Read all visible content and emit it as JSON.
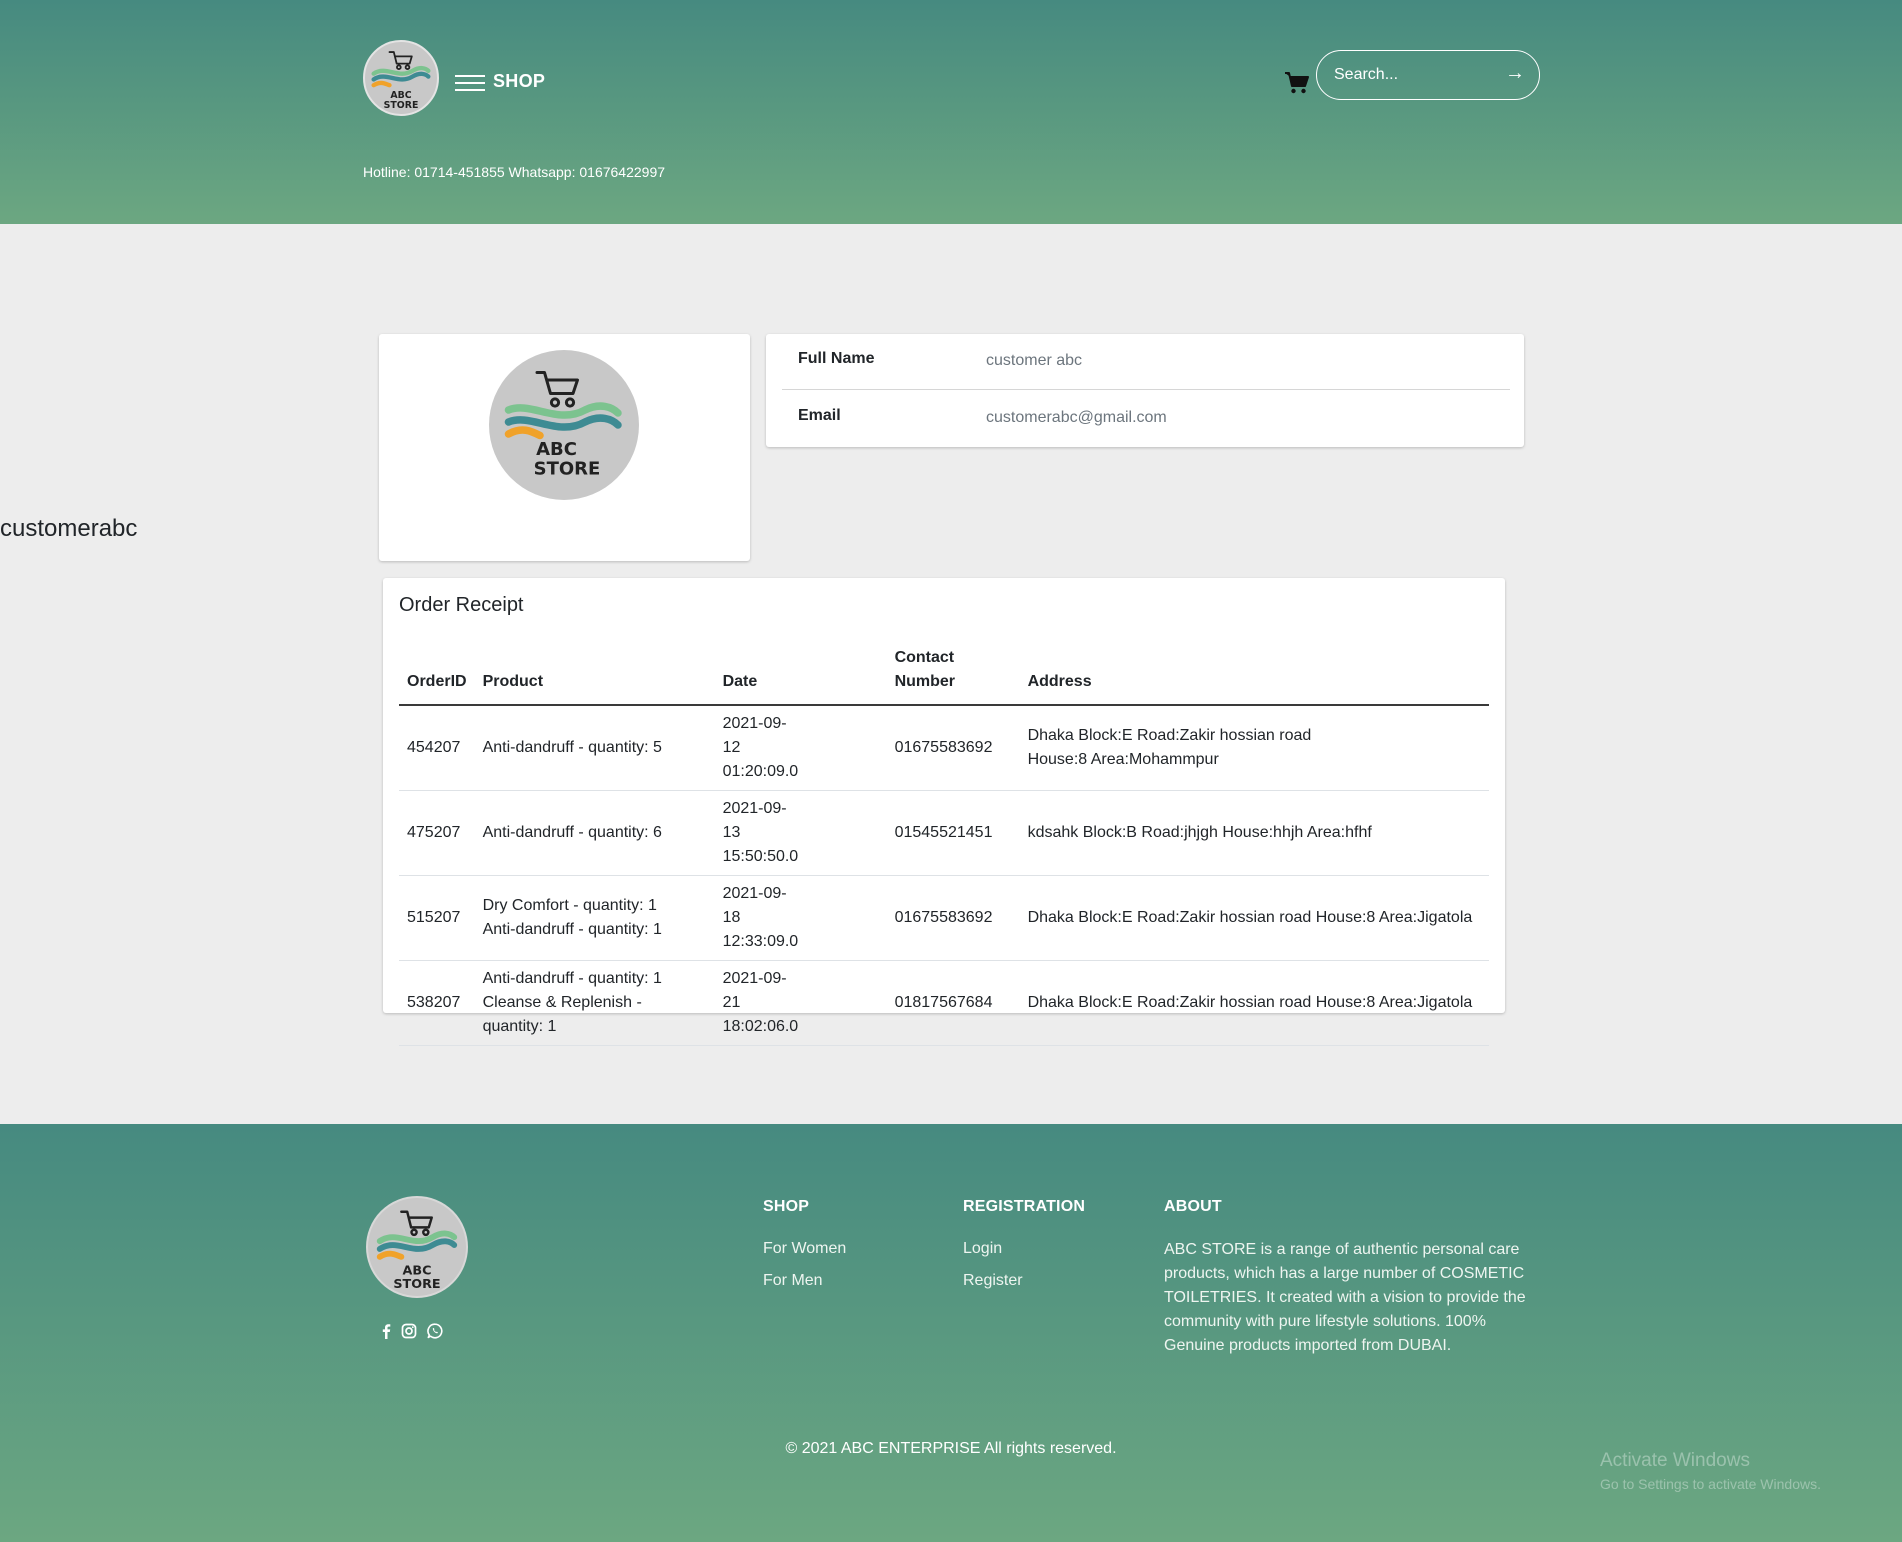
{
  "header": {
    "brand_label": "SHOP",
    "logo_text_line1": "ABC",
    "logo_text_line2": "STORE",
    "search_placeholder": "Search...",
    "search_arrow": "→",
    "hotline": "Hotline: 01714-451855 Whatsapp: 01676422997"
  },
  "profile": {
    "username": "customerabc",
    "full_name_label": "Full Name",
    "full_name_value": "customer abc",
    "email_label": "Email",
    "email_value": "customerabc@gmail.com"
  },
  "orders": {
    "title": "Order Receipt",
    "columns": [
      "OrderID",
      "Product",
      "Date",
      "Contact Number",
      "Address"
    ],
    "rows": [
      {
        "id": "454207",
        "product": "Anti-dandruff - quantity: 5",
        "date": "2021-09-12 01:20:09.0",
        "contact": "01675583692",
        "address": "Dhaka Block:E Road:Zakir hossian road House:8 Area:Mohammpur"
      },
      {
        "id": "475207",
        "product": "Anti-dandruff - quantity: 6",
        "date": "2021-09-13 15:50:50.0",
        "contact": "01545521451",
        "address": "kdsahk Block:B Road:jhjgh House:hhjh Area:hfhf"
      },
      {
        "id": "515207",
        "product": "Dry Comfort - quantity: 1 Anti-dandruff - quantity: 1",
        "date": "2021-09-18 12:33:09.0",
        "contact": "01675583692",
        "address": "Dhaka Block:E Road:Zakir hossian road House:8 Area:Jigatola"
      },
      {
        "id": "538207",
        "product": "Anti-dandruff - quantity: 1 Cleanse & Replenish - quantity: 1",
        "date": "2021-09-21 18:02:06.0",
        "contact": "01817567684",
        "address": "Dhaka Block:E Road:Zakir hossian road House:8 Area:Jigatola"
      }
    ]
  },
  "footer": {
    "shop_heading": "SHOP",
    "shop_links": [
      "For Women",
      "For Men"
    ],
    "registration_heading": "REGISTRATION",
    "registration_links": [
      "Login",
      "Register"
    ],
    "about_heading": "ABOUT",
    "about_text": "ABC STORE is a range of authentic personal care products, which has a large number of COSMETIC TOILETRIES. It created with a vision to provide the community with pure lifestyle solutions. 100% Genuine products imported from DUBAI.",
    "social_icons": [
      "facebook-icon",
      "instagram-icon",
      "whatsapp-icon"
    ],
    "copyright": "© 2021 ABC ENTERPRISE All rights reserved."
  },
  "overlay": {
    "activate_title": "Activate Windows",
    "activate_sub": "Go to Settings to activate Windows."
  },
  "colors": {
    "gradient_top": "#468a80",
    "gradient_bottom": "#6ca781",
    "page_bg": "#ededed",
    "logo_orange": "#f0a22a",
    "logo_teal": "#3e8b93",
    "logo_green": "#7cc38f"
  }
}
